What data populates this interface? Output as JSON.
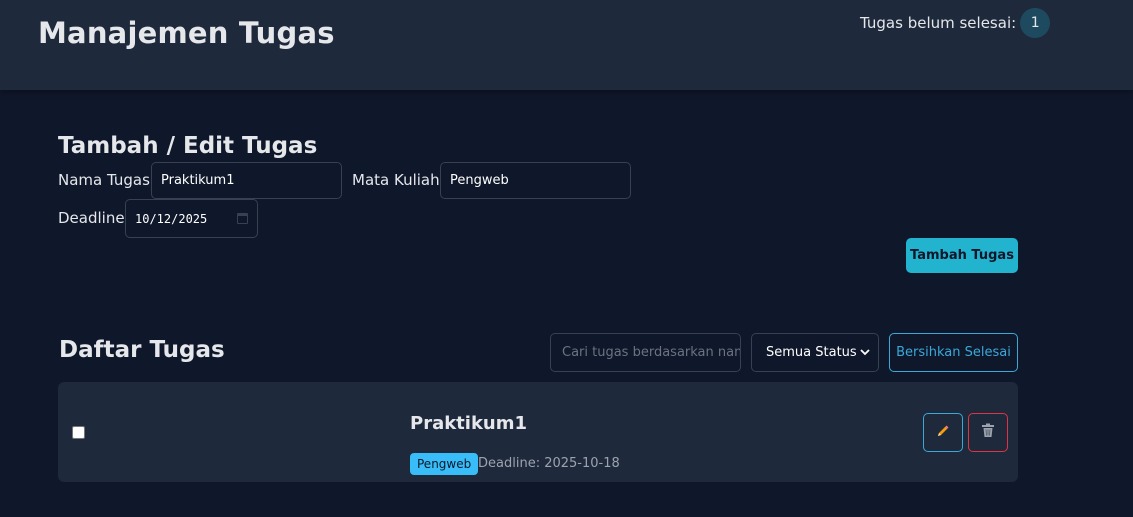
{
  "header": {
    "title": "Manajemen Tugas",
    "pending_label": "Tugas belum selesai:",
    "pending_count": "1"
  },
  "form": {
    "title": "Tambah / Edit Tugas",
    "name_label": "Nama Tugas",
    "name_value": "Praktikum1",
    "course_label": "Mata Kuliah",
    "course_value": "Pengweb",
    "deadline_label": "Deadline",
    "deadline_value": "10/12/2025",
    "submit_label": "Tambah Tugas"
  },
  "list": {
    "title": "Daftar Tugas",
    "search_placeholder": "Cari tugas berdasarkan nama...",
    "filter_selected": "Semua Status",
    "clear_label": "Bersihkan Selesai",
    "tasks": [
      {
        "name": "Praktikum1",
        "course": "Pengweb",
        "deadline": "Deadline: 2025-10-18",
        "done": false
      }
    ]
  },
  "colors": {
    "background": "#0f172a",
    "surface": "#1e293b",
    "accent": "#22b3cf",
    "outline_blue": "#3aa8d8",
    "danger": "#dc3545"
  },
  "icons": {
    "edit": "pencil-icon",
    "delete": "trash-icon",
    "calendar": "calendar-icon",
    "dropdown": "chevron-down-icon"
  }
}
